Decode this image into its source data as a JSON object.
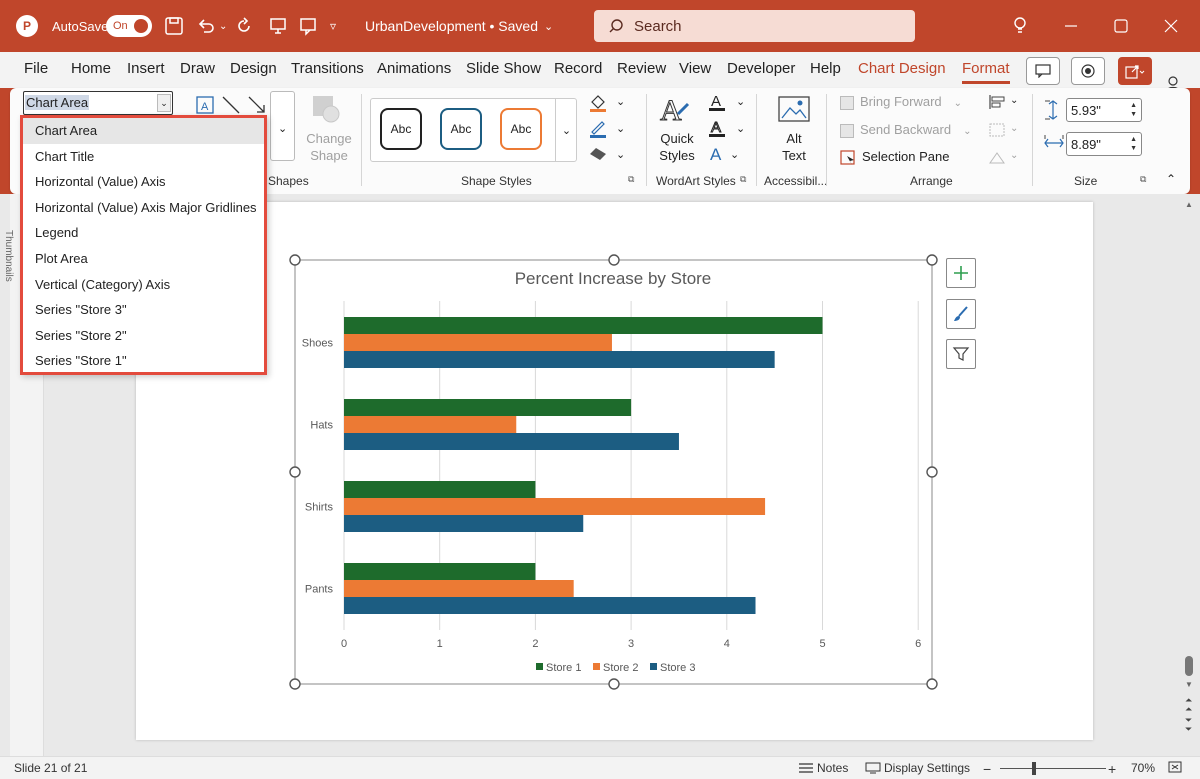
{
  "titlebar": {
    "autosave_label": "AutoSave",
    "autosave_state": "On",
    "doc_title": "UrbanDevelopment • Saved",
    "search_placeholder": "Search"
  },
  "tabs": [
    "File",
    "Home",
    "Insert",
    "Draw",
    "Design",
    "Transitions",
    "Animations",
    "Slide Show",
    "Record",
    "Review",
    "View",
    "Developer",
    "Help",
    "Chart Design",
    "Format"
  ],
  "active_tab": "Format",
  "ribbon": {
    "selection_value": "Chart Area",
    "change_shape_label": "Change Shape",
    "shapes_group": "Shapes",
    "shape_styles_group": "Shape Styles",
    "shape_style_sample": "Abc",
    "quick_styles_label": "Quick Styles",
    "wordart_group": "WordArt Styles",
    "alt_text_label": "Alt Text",
    "accessibility_group": "Accessibil...",
    "bring_forward": "Bring Forward",
    "send_backward": "Send Backward",
    "selection_pane": "Selection Pane",
    "arrange_group": "Arrange",
    "height_value": "5.93\"",
    "width_value": "8.89\"",
    "size_group": "Size"
  },
  "dropdown": {
    "items": [
      "Chart Area",
      "Chart Title",
      "Horizontal (Value) Axis",
      "Horizontal (Value) Axis Major Gridlines",
      "Legend",
      "Plot Area",
      "Vertical (Category) Axis",
      "Series \"Store 3\"",
      "Series \"Store 2\"",
      "Series \"Store 1\""
    ],
    "selected_index": 0
  },
  "thumbnails_label": "Thumbnails",
  "status": {
    "slide_info": "Slide 21 of 21",
    "notes": "Notes",
    "display_settings": "Display Settings",
    "zoom": "70%"
  },
  "colors": {
    "accent": "#c0462b",
    "store1": "#1e6b2c",
    "store2": "#ec7a34",
    "store3": "#1c5d82",
    "dropdown_highlight": "#e34b3d"
  },
  "chart_data": {
    "type": "bar",
    "orientation": "horizontal",
    "title": "Percent Increase by Store",
    "categories": [
      "Shoes",
      "Hats",
      "Shirts",
      "Pants"
    ],
    "series": [
      {
        "name": "Store 1",
        "values": [
          5,
          3,
          2,
          2
        ]
      },
      {
        "name": "Store 2",
        "values": [
          2.8,
          1.8,
          4.4,
          2.4
        ]
      },
      {
        "name": "Store 3",
        "values": [
          4.5,
          3.5,
          2.5,
          4.3
        ]
      }
    ],
    "xlim": [
      0,
      6
    ],
    "xticks": [
      "0",
      "1",
      "2",
      "3",
      "4",
      "5",
      "6"
    ],
    "grid": true,
    "legend_position": "bottom"
  }
}
